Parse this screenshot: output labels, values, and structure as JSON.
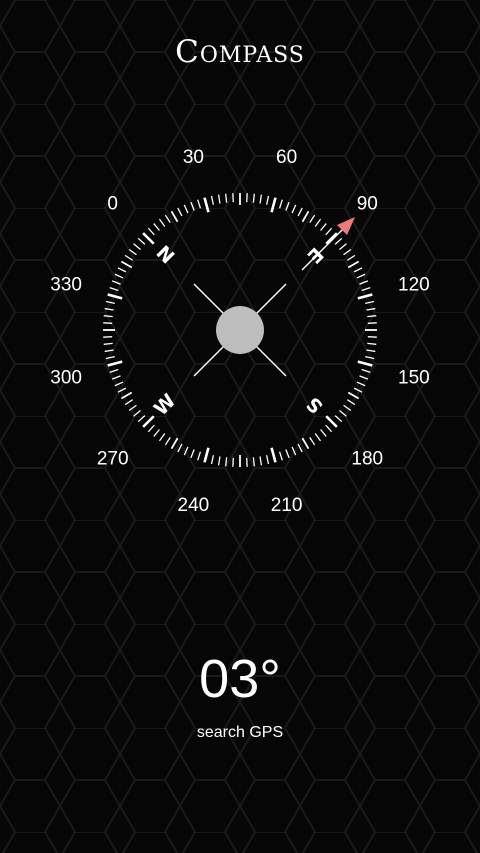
{
  "app": {
    "title": "Compass"
  },
  "compass": {
    "heading_degrees": 3,
    "degree_labels": [
      "0",
      "30",
      "60",
      "90",
      "120",
      "150",
      "180",
      "210",
      "240",
      "270",
      "300",
      "330"
    ],
    "cardinals": [
      "N",
      "E",
      "S",
      "W"
    ],
    "colors": {
      "background": "#060606",
      "hex_stroke": "#1a1a1a",
      "ring": "#ffffff",
      "center_disc": "#bdbdbd",
      "pointer": "#f07a7a"
    },
    "icons": {
      "pointer": "arrow-pointer-icon",
      "crosshair": "crosshair-icon"
    }
  },
  "readout": {
    "heading_text": "03°",
    "status_text": "search GPS"
  }
}
